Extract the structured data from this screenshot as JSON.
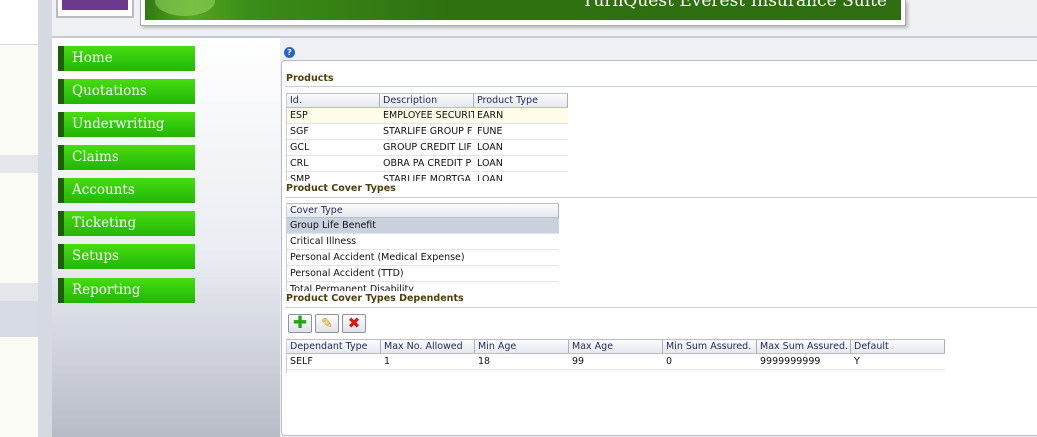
{
  "header": {
    "banner_title": "TurnQuest Everest Insurance Suite"
  },
  "nav": {
    "items": [
      {
        "label": "Home"
      },
      {
        "label": "Quotations"
      },
      {
        "label": "Underwriting"
      },
      {
        "label": "Claims"
      },
      {
        "label": "Accounts"
      },
      {
        "label": "Ticketing"
      },
      {
        "label": "Setups"
      },
      {
        "label": "Reporting"
      }
    ]
  },
  "products": {
    "title": "Products",
    "columns": [
      "Id.",
      "Description",
      "Product Type"
    ],
    "rows": [
      [
        "ESP",
        "EMPLOYEE SECURITY",
        "EARN"
      ],
      [
        "SGF",
        "STARLIFE GROUP F",
        "FUNE"
      ],
      [
        "GCL",
        "GROUP CREDIT LIF",
        "LOAN"
      ],
      [
        "CRL",
        "OBRA PA CREDIT P",
        "LOAN"
      ],
      [
        "SMP",
        "STARLIFE MORTGA",
        "LOAN"
      ]
    ]
  },
  "cover_types": {
    "title": "Product Cover Types",
    "columns": [
      "Cover Type"
    ],
    "rows": [
      [
        "Group Life Benefit"
      ],
      [
        "Critical Illness"
      ],
      [
        "Personal Accident (Medical Expense)"
      ],
      [
        "Personal Accident (TTD)"
      ],
      [
        "Total Permanent Disability"
      ]
    ]
  },
  "dependents": {
    "title": "Product Cover Types Dependents",
    "toolbar": {
      "add_icon": "plus-icon",
      "edit_icon": "pencil-icon",
      "delete_icon": "x-icon"
    },
    "columns": [
      "Dependant Type",
      "Max No. Allowed",
      "Min Age",
      "Max Age",
      "Min Sum Assured.",
      "Max Sum Assured.",
      "Default"
    ],
    "rows": [
      [
        "SELF",
        "1",
        "18",
        "99",
        "0",
        "9999999999",
        "Y"
      ]
    ]
  },
  "colors": {
    "nav_green": "#2fc60b",
    "section_title": "#4e3f0c",
    "selected_row": "#c9d0de"
  }
}
